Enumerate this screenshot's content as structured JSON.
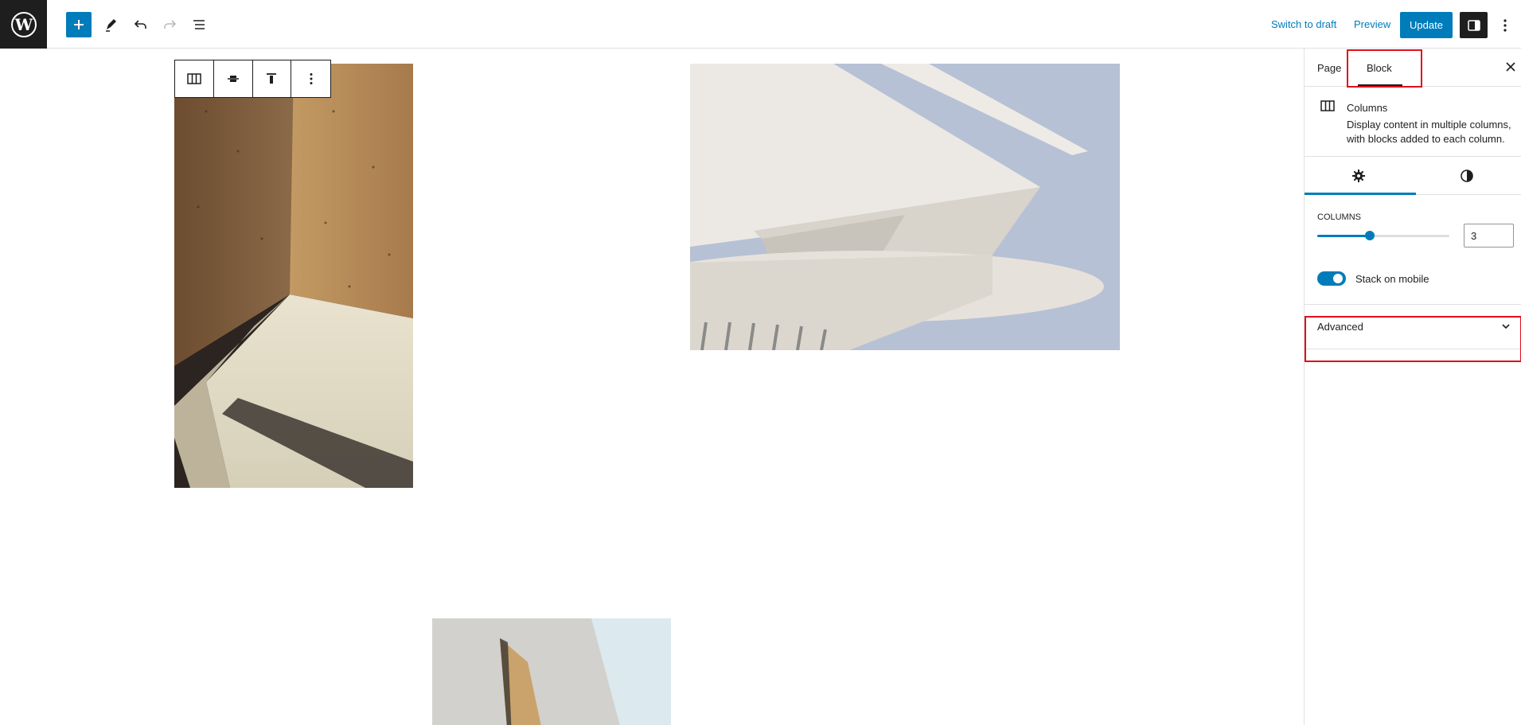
{
  "topbar": {
    "logo_icon": "wordpress-logo-icon",
    "add_icon": "plus-icon",
    "tools_icon": "pencil-icon",
    "undo_icon": "undo-icon",
    "redo_icon": "redo-icon",
    "list_view_icon": "list-view-icon",
    "switch_to_draft": "Switch to draft",
    "preview": "Preview",
    "update": "Update",
    "settings_icon": "sidebar-settings-icon",
    "options_icon": "more-vertical-icon"
  },
  "block_toolbar": {
    "items": [
      "columns-icon",
      "align-center-icon",
      "align-top-icon",
      "more-vertical-icon"
    ]
  },
  "sidebar": {
    "tabs": {
      "page": "Page",
      "block": "Block"
    },
    "block_card": {
      "title": "Columns",
      "description": "Display content in multiple columns, with blocks added to each column."
    },
    "sub_tabs": [
      "settings-gear-icon",
      "styles-contrast-icon"
    ],
    "columns": {
      "label": "Columns",
      "value": "3",
      "slider_fraction": 0.4
    },
    "stack_on_mobile": {
      "label": "Stack on mobile",
      "checked": true
    },
    "advanced": {
      "label": "Advanced"
    }
  },
  "colors": {
    "accent": "#007cba",
    "dark": "#1e1e1e",
    "highlight": "#e0101a"
  }
}
